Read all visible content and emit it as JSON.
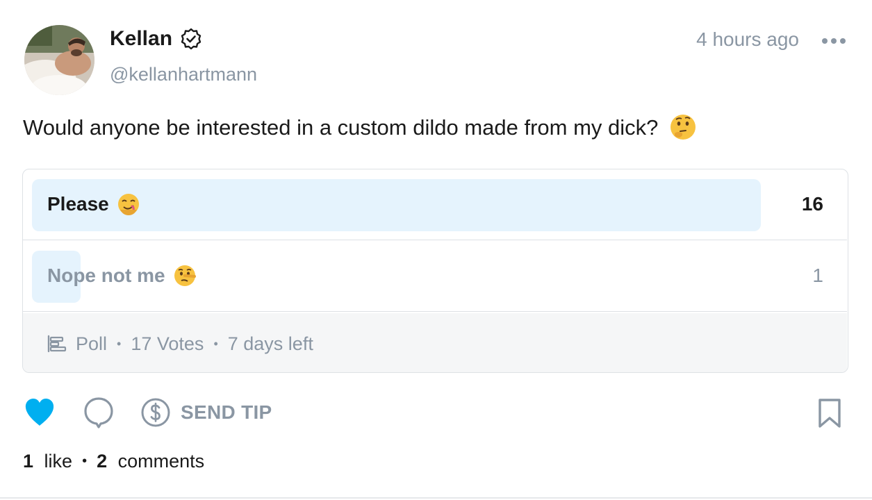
{
  "author": {
    "display_name": "Kellan",
    "handle": "@kellanhartmann",
    "verified": true
  },
  "post": {
    "timestamp": "4 hours ago",
    "text": "Would anyone be interested in a custom dildo made from my dick?",
    "text_emoji": "thinking-face"
  },
  "poll": {
    "options": [
      {
        "label": "Please",
        "emoji": "drooling-face",
        "votes": "16",
        "fraction": 0.94
      },
      {
        "label": "Nope not me",
        "emoji": "lying-face",
        "votes": "1",
        "fraction": 0.06
      }
    ],
    "type_label": "Poll",
    "votes_label": "17 Votes",
    "time_left": "7 days left"
  },
  "actions": {
    "tip_label": "SEND TIP",
    "liked": true
  },
  "stats": {
    "likes_count": "1",
    "likes_word": "like",
    "comments_count": "2",
    "comments_word": "comments"
  },
  "colors": {
    "accent": "#00aff0",
    "muted": "#8a96a3",
    "poll_fill": "#e5f3fd",
    "border": "#dde1e5"
  }
}
